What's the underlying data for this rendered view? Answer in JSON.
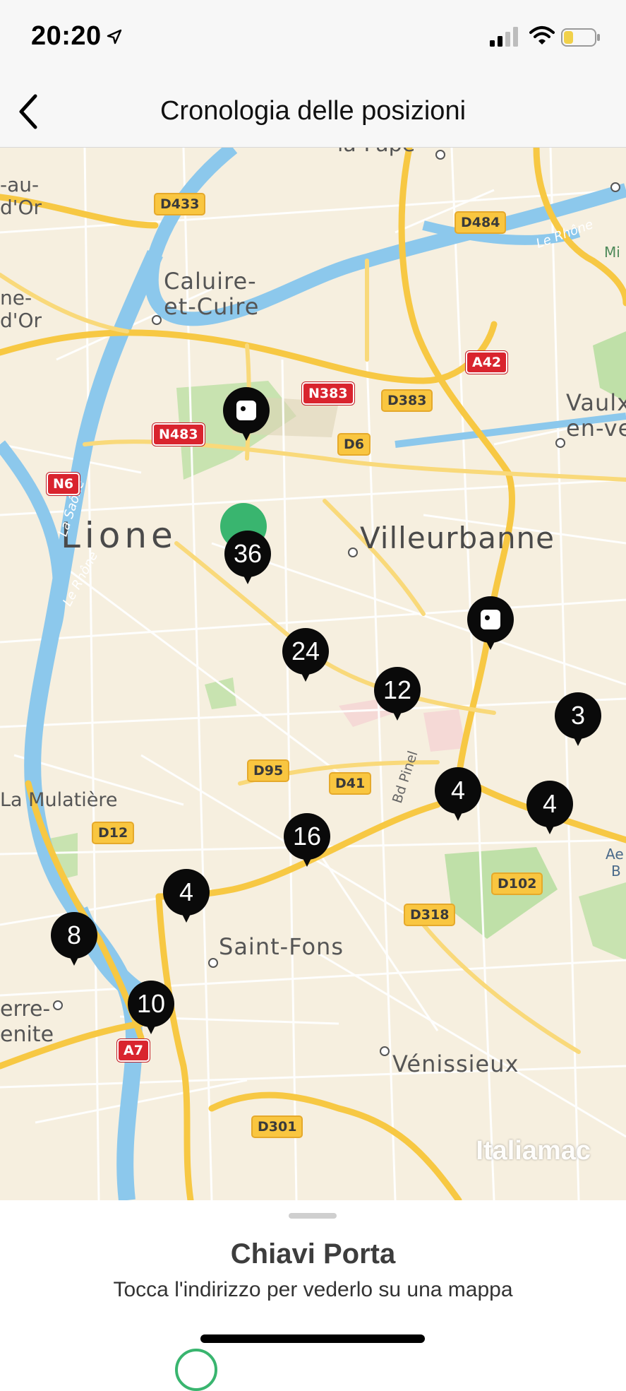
{
  "status": {
    "time": "20:20",
    "icons": [
      "location-arrow-icon",
      "cellular-signal-icon",
      "wifi-icon",
      "battery-icon"
    ]
  },
  "nav": {
    "back_icon": "chevron-left-icon",
    "title": "Cronologia delle posizioni"
  },
  "map": {
    "cities": {
      "lione": "Lione",
      "villeurbanne": "Villeurbanne",
      "caluire_1": "Caluire-",
      "caluire_2": "et-Cuire",
      "saint_fons": "Saint-Fons",
      "venissieux": "Vénissieux",
      "vaulx_1": "Vaulx",
      "vaulx_2": "en-ve",
      "mulatiere": "La Mulatière",
      "rilleux_1": "-au-",
      "rilleux_2": "d'Or",
      "ne_1": "ne-",
      "ne_2": "d'Or",
      "pierre_1": "erre-",
      "pierre_2": "enite",
      "top_partial": "la-Pape",
      "mi": "Mi",
      "ae": "Ae",
      "b": "B"
    },
    "rivers": {
      "rhone_top": "Le Rhône",
      "saone": "La Saône",
      "rhone_left": "Le Rhône"
    },
    "street": "Bd Pinel",
    "roads": {
      "d433": "D433",
      "d484": "D484",
      "a42": "A42",
      "n383": "N383",
      "d383": "D383",
      "n483": "N483",
      "d6": "D6",
      "n6": "N6",
      "d95": "D95",
      "d41": "D41",
      "d12": "D12",
      "d102": "D102",
      "d318": "D318",
      "a7": "A7",
      "d301": "D301"
    },
    "pins": {
      "p36": "36",
      "p24": "24",
      "p12": "12",
      "p3": "3",
      "p4a": "4",
      "p4b": "4",
      "p16": "16",
      "p4c": "4",
      "p8": "8",
      "p10": "10"
    },
    "pin_icons": [
      "door-sensor-icon",
      "door-sensor-icon",
      "door-sensor-icon"
    ],
    "watermark": "Italiamac",
    "colors": {
      "land": "#f6efdf",
      "water": "#8cc8ec",
      "road_major": "#f7c843",
      "road_minor": "#ffffff",
      "park": "#bfe0a8",
      "pin": "#0a0a0a",
      "current_location": "#39b56f"
    }
  },
  "sheet": {
    "title": "Chiavi Porta",
    "subtitle": "Tocca l'indirizzo per vederlo su una mappa"
  }
}
